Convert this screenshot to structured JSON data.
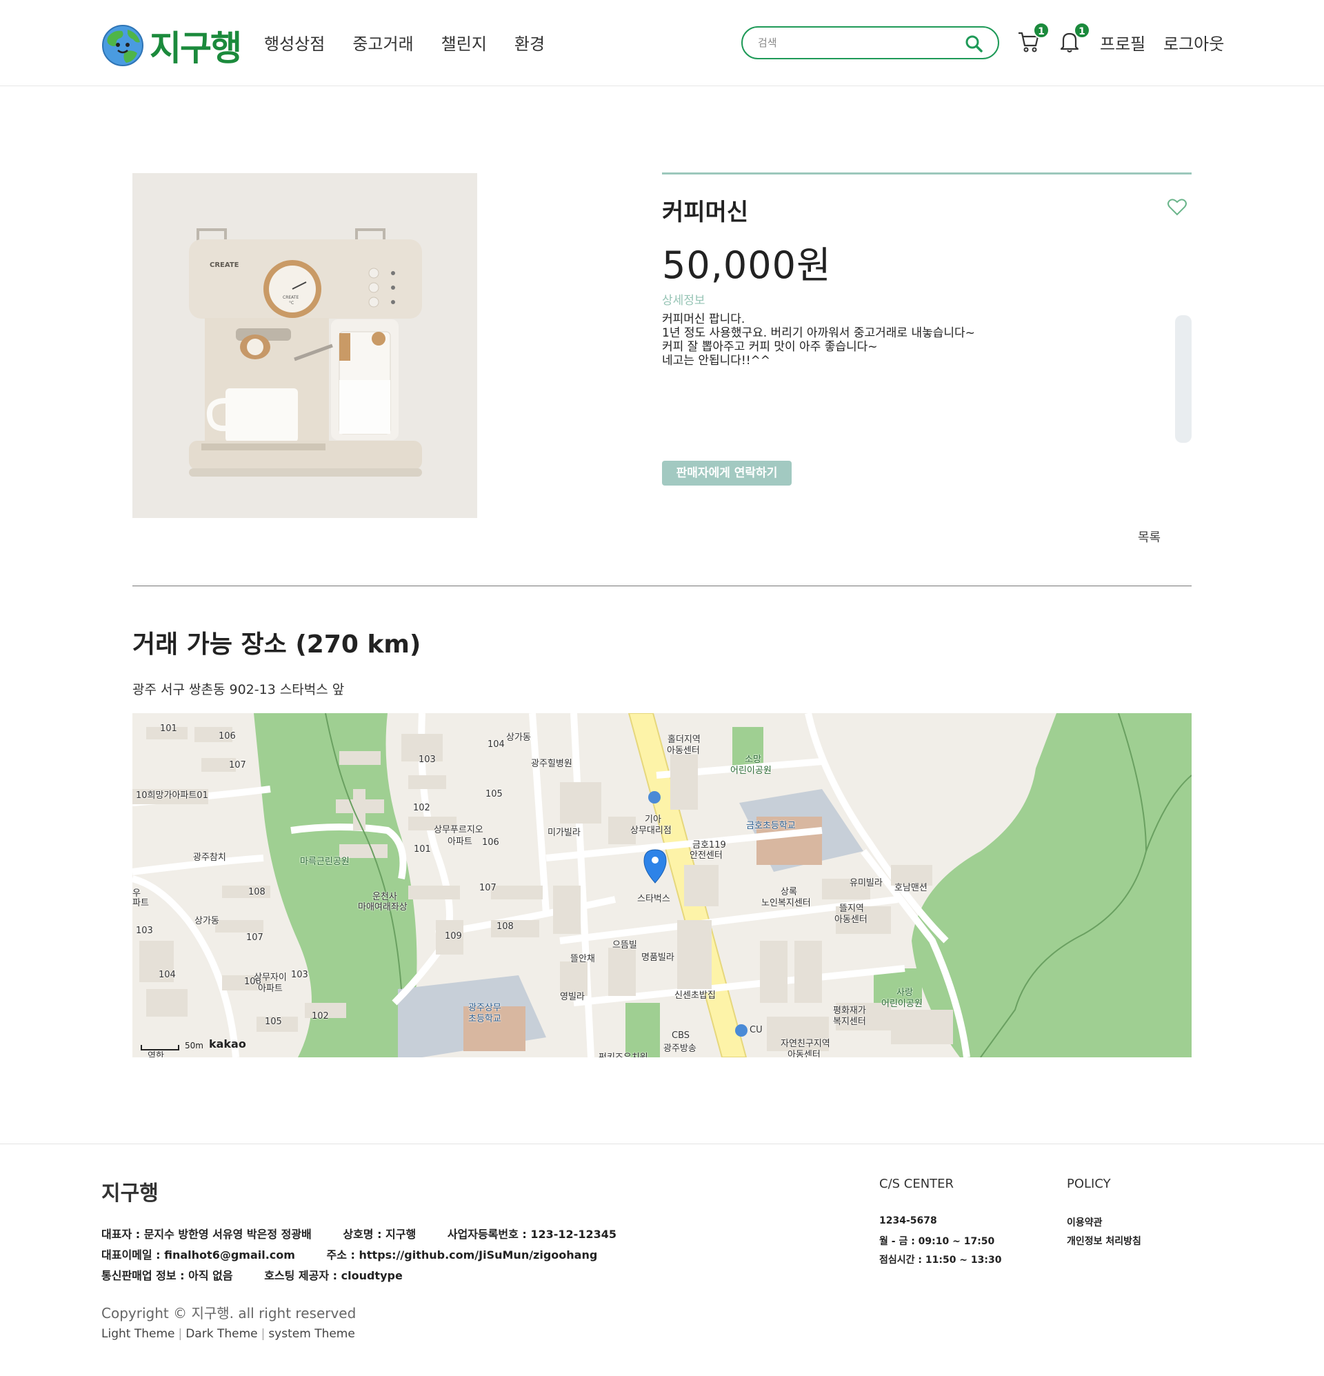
{
  "header": {
    "logo_text": "지구행",
    "nav": [
      "행성상점",
      "중고거래",
      "챌린지",
      "환경"
    ],
    "search_placeholder": "검색",
    "cart_count": "1",
    "alarm_count": "1",
    "profile_label": "프로필",
    "logout_label": "로그아웃"
  },
  "product": {
    "title": "커피머신",
    "price": "50,000원",
    "detail_label": "상세정보",
    "description_lines": [
      "커피머신 팝니다.",
      "1년 정도 사용했구요. 버리기 아까워서 중고거래로 내놓습니다~",
      "커피 잘 뽑아주고 커피 맛이 아주 좋습니다~",
      "네고는 안됩니다!!^^"
    ],
    "contact_button": "판매자에게 연락하기",
    "list_link": "목록",
    "image_brand": "CREATE",
    "image_dial_brand": "CREATE",
    "image_dial_unit": "°C"
  },
  "location": {
    "title": "거래 가능 장소 (270 km)",
    "address": "광주 서구 쌍촌동 902-13 스타벅스 앞",
    "map_labels": [
      "101",
      "106",
      "107",
      "10희망가아파트01",
      "광주참치",
      "우",
      "파트",
      "상가동",
      "103",
      "104",
      "108",
      "107",
      "106",
      "상무자이",
      "103",
      "아파트",
      "105",
      "102",
      "마륵근린공원",
      "운천사",
      "마애여래좌상",
      "103",
      "102",
      "101",
      "상무푸르지오",
      "아파트",
      "106",
      "105",
      "107",
      "108",
      "109",
      "104",
      "상가동",
      "광주힐병원",
      "광주상무",
      "초등학교",
      "미가빌라",
      "뜰안채",
      "으뜸빌",
      "영빌라",
      "명품빌라",
      "기아",
      "상무대리점",
      "스타벅스",
      "홀더지역",
      "아동센터",
      "소망",
      "어린이공원",
      "금호119",
      "안전센터",
      "금호초등학교",
      "상록",
      "노인복지센터",
      "유미빌라",
      "호남맨션",
      "뜰지역",
      "아동센터",
      "신센초밥집",
      "CU",
      "CBS",
      "광주방송",
      "자연친구지역",
      "아동센터",
      "평화재가",
      "복지센터",
      "사랑",
      "어린이공원",
      "50m",
      "kakao",
      "역한",
      "펀키즈유치원"
    ]
  },
  "footer": {
    "brand": "지구행",
    "info_row1": [
      "대표자 : 문지수 방한영 서유영 박은정 정광배",
      "상호명 : 지구행",
      "사업자등록번호 : 123-12-12345"
    ],
    "info_row2": [
      "대표이메일 : finalhot6@gmail.com",
      "주소 : https://github.com/JiSuMun/zigoohang"
    ],
    "info_row3": [
      "통신판매업 정보 : 아직 없음",
      "호스팅 제공자 : cloudtype"
    ],
    "copyright": "Copyright © 지구행. all right reserved",
    "theme_links": [
      "Light Theme",
      "Dark Theme",
      "system Theme"
    ],
    "cs_title": "C/S CENTER",
    "cs_items": [
      "1234-5678",
      "월 - 금 : 09:10 ~ 17:50",
      "점심시간 : 11:50 ~ 13:30"
    ],
    "policy_title": "POLICY",
    "policy_items": [
      "이용약관",
      "개인정보 처리방침"
    ]
  },
  "colors": {
    "brand_green": "#1b8a3c",
    "search_border": "#1f9a58",
    "accent_mint": "#9cc8bc",
    "button_mint": "#a2c9c1",
    "map_park": "#9fcf92",
    "map_road": "#fdf3a8"
  },
  "icons": [
    "globe-logo-icon",
    "search-icon",
    "cart-icon",
    "bell-icon",
    "heart-icon",
    "map-pin-icon"
  ]
}
